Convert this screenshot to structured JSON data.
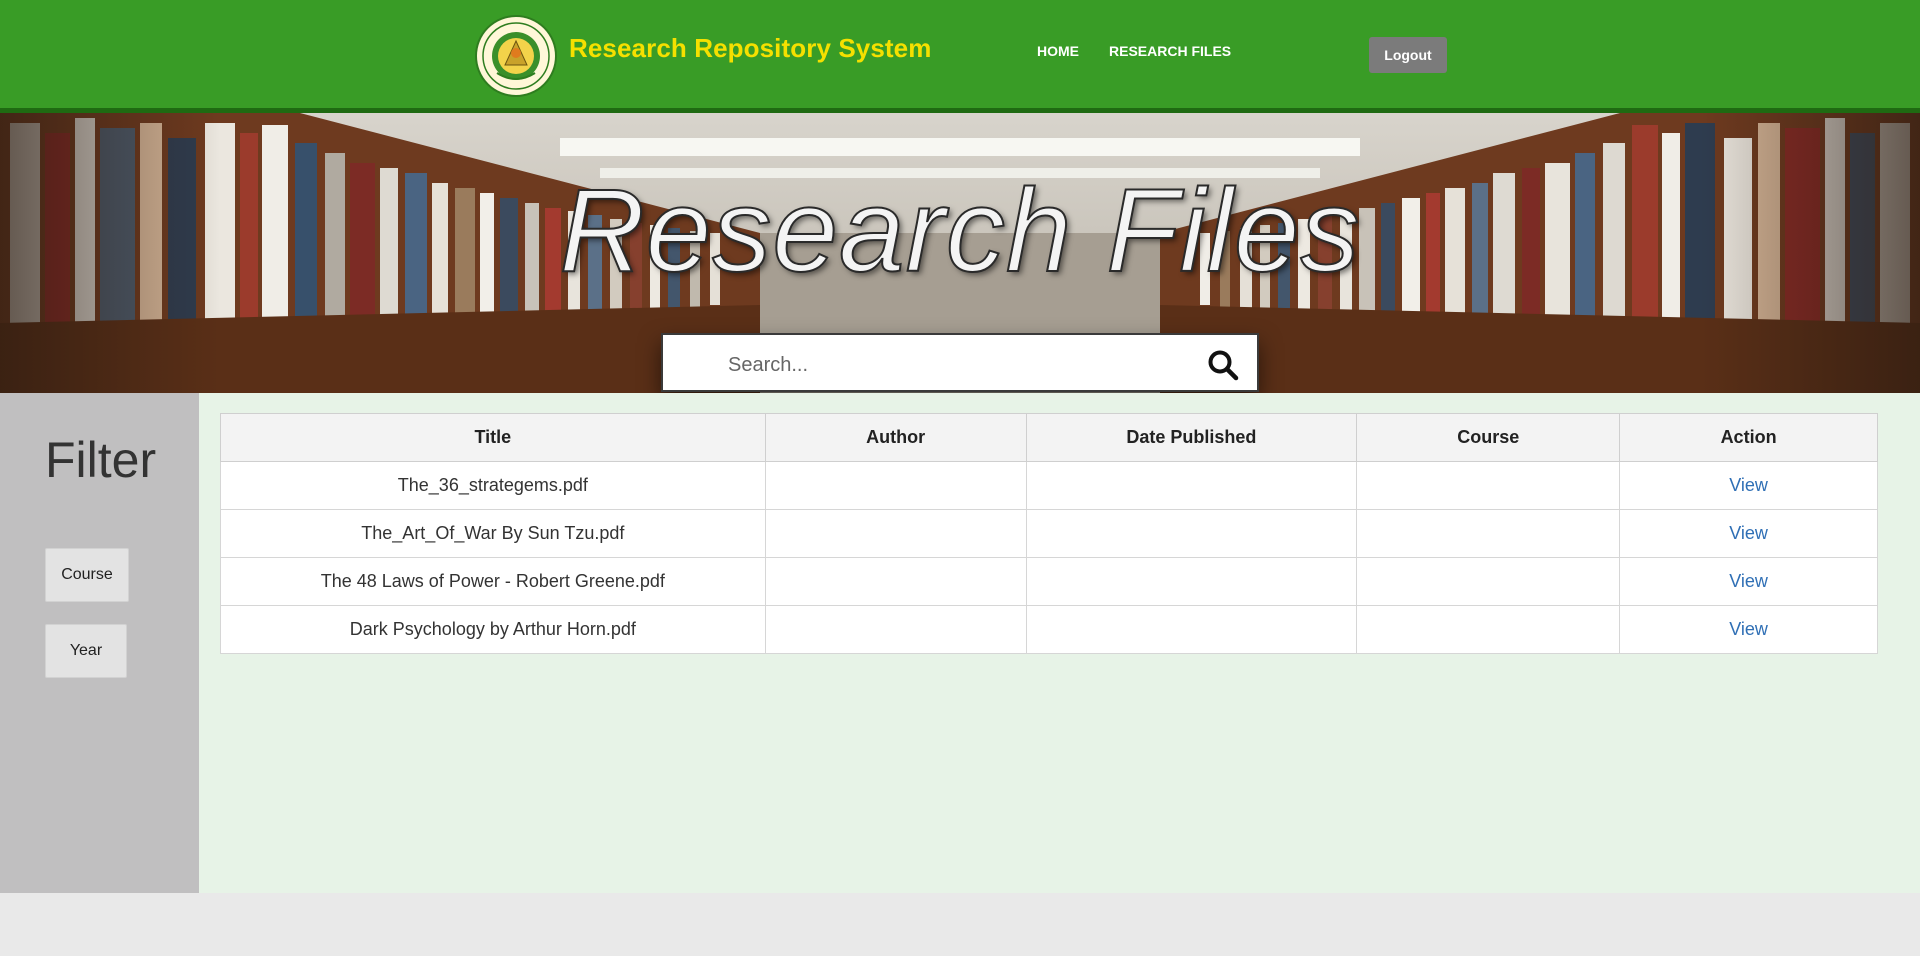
{
  "header": {
    "brand": "Research Repository System",
    "logo_text_top": "UNIVERSIDAD DE MANILA",
    "logo_text_bottom": "UNIVERSITY OF MANILA",
    "nav": [
      {
        "label": "HOME"
      },
      {
        "label": "RESEARCH FILES"
      }
    ],
    "logout_label": "Logout"
  },
  "hero": {
    "title": "Research Files",
    "search_placeholder": "Search..."
  },
  "sidebar": {
    "title": "Filter",
    "buttons": [
      {
        "label": "Course"
      },
      {
        "label": "Year"
      }
    ]
  },
  "table": {
    "columns": [
      "Title",
      "Author",
      "Date Published",
      "Course",
      "Action"
    ],
    "rows": [
      {
        "title": "The_36_strategems.pdf",
        "author": "",
        "date": "",
        "course": "",
        "action": "View"
      },
      {
        "title": "The_Art_Of_War By Sun Tzu.pdf",
        "author": "",
        "date": "",
        "course": "",
        "action": "View"
      },
      {
        "title": "The 48 Laws of Power - Robert Greene.pdf",
        "author": "",
        "date": "",
        "course": "",
        "action": "View"
      },
      {
        "title": "Dark Psychology by Arthur Horn.pdf",
        "author": "",
        "date": "",
        "course": "",
        "action": "View"
      }
    ]
  },
  "colors": {
    "header_green": "#399c26",
    "brand_yellow": "#f5e000",
    "content_bg": "#e7f3e7",
    "sidebar_bg": "#c0bfc0",
    "link_blue": "#2f6fb5"
  }
}
